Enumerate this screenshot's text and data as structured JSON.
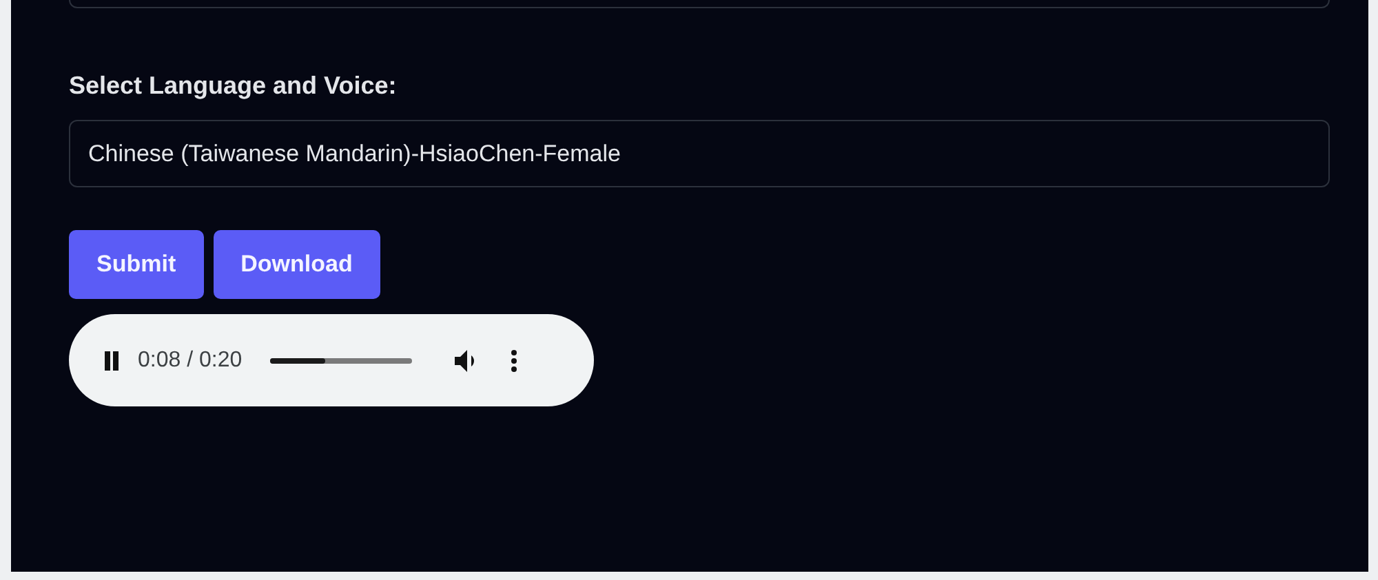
{
  "voice_label": "Select Language and Voice:",
  "voice_field": {
    "value": "Chinese (Taiwanese Mandarin)-HsiaoChen-Female"
  },
  "buttons": [
    "Submit",
    "Download"
  ],
  "audio_player": {
    "playing": true,
    "time": "0:08 / 0:20",
    "level": 0.39
  }
}
